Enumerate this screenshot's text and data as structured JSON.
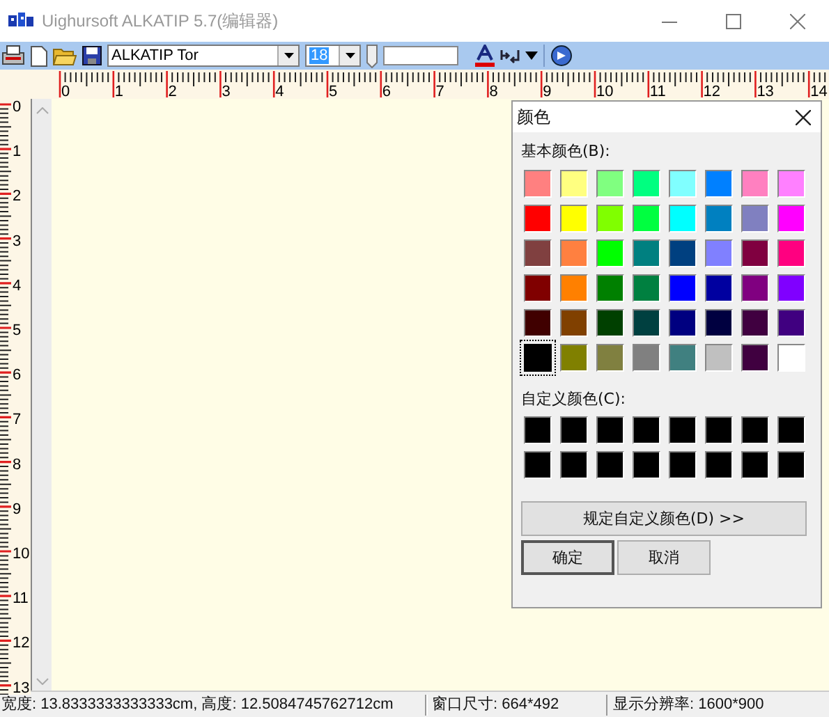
{
  "window": {
    "title": "Uighursoft ALKATIP 5.7(编辑器)"
  },
  "toolbar": {
    "font": "ALKATIP Tor",
    "size": "18"
  },
  "ruler": {
    "horizontal": [
      "0",
      "1",
      "2",
      "3",
      "4",
      "5",
      "6",
      "7",
      "8",
      "9",
      "10",
      "11",
      "12",
      "13",
      "14"
    ],
    "vertical": [
      "0",
      "1",
      "2",
      "3",
      "4",
      "5",
      "6",
      "7",
      "8",
      "9",
      "10",
      "11",
      "12",
      "13"
    ]
  },
  "dialog": {
    "title": "颜色",
    "basic_label": "基本颜色(B):",
    "basic_colors": [
      {
        "color": "#ff8080",
        "selected": false
      },
      {
        "color": "#ffff80",
        "selected": false
      },
      {
        "color": "#80ff80",
        "selected": false
      },
      {
        "color": "#00ff80",
        "selected": false
      },
      {
        "color": "#80ffff",
        "selected": false
      },
      {
        "color": "#0080ff",
        "selected": false
      },
      {
        "color": "#ff80c0",
        "selected": false
      },
      {
        "color": "#ff80ff",
        "selected": false
      },
      {
        "color": "#ff0000",
        "selected": false
      },
      {
        "color": "#ffff00",
        "selected": false
      },
      {
        "color": "#80ff00",
        "selected": false
      },
      {
        "color": "#00ff40",
        "selected": false
      },
      {
        "color": "#00ffff",
        "selected": false
      },
      {
        "color": "#0080c0",
        "selected": false
      },
      {
        "color": "#8080c0",
        "selected": false
      },
      {
        "color": "#ff00ff",
        "selected": false
      },
      {
        "color": "#804040",
        "selected": false
      },
      {
        "color": "#ff8040",
        "selected": false
      },
      {
        "color": "#00ff00",
        "selected": false
      },
      {
        "color": "#008080",
        "selected": false
      },
      {
        "color": "#004080",
        "selected": false
      },
      {
        "color": "#8080ff",
        "selected": false
      },
      {
        "color": "#800040",
        "selected": false
      },
      {
        "color": "#ff0080",
        "selected": false
      },
      {
        "color": "#800000",
        "selected": false
      },
      {
        "color": "#ff8000",
        "selected": false
      },
      {
        "color": "#008000",
        "selected": false
      },
      {
        "color": "#008040",
        "selected": false
      },
      {
        "color": "#0000ff",
        "selected": false
      },
      {
        "color": "#0000a0",
        "selected": false
      },
      {
        "color": "#800080",
        "selected": false
      },
      {
        "color": "#8000ff",
        "selected": false
      },
      {
        "color": "#400000",
        "selected": false
      },
      {
        "color": "#804000",
        "selected": false
      },
      {
        "color": "#004000",
        "selected": false
      },
      {
        "color": "#004040",
        "selected": false
      },
      {
        "color": "#000080",
        "selected": false
      },
      {
        "color": "#000040",
        "selected": false
      },
      {
        "color": "#400040",
        "selected": false
      },
      {
        "color": "#400080",
        "selected": false
      },
      {
        "color": "#000000",
        "selected": true
      },
      {
        "color": "#808000",
        "selected": false
      },
      {
        "color": "#808040",
        "selected": false
      },
      {
        "color": "#808080",
        "selected": false
      },
      {
        "color": "#408080",
        "selected": false
      },
      {
        "color": "#c0c0c0",
        "selected": false
      },
      {
        "color": "#400040",
        "selected": false
      },
      {
        "color": "#ffffff",
        "selected": false
      }
    ],
    "custom_label": "自定义颜色(C):",
    "custom_colors": [
      {
        "color": "#000000"
      },
      {
        "color": "#000000"
      },
      {
        "color": "#000000"
      },
      {
        "color": "#000000"
      },
      {
        "color": "#000000"
      },
      {
        "color": "#000000"
      },
      {
        "color": "#000000"
      },
      {
        "color": "#000000"
      },
      {
        "color": "#000000"
      },
      {
        "color": "#000000"
      },
      {
        "color": "#000000"
      },
      {
        "color": "#000000"
      },
      {
        "color": "#000000"
      },
      {
        "color": "#000000"
      },
      {
        "color": "#000000"
      },
      {
        "color": "#000000"
      }
    ],
    "define_button": "规定自定义颜色(D) >>",
    "ok_button": "确定",
    "cancel_button": "取消"
  },
  "status_bar": [
    "宽度: 13.8333333333333cm, 高度: 12.5084745762712cm",
    "窗口尺寸: 664*492",
    "显示分辨率: 1600*900"
  ]
}
